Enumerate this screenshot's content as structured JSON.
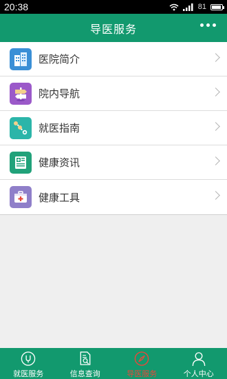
{
  "status_bar": {
    "time": "20:38",
    "battery_text": "81",
    "battery_level": 0.81
  },
  "header": {
    "title": "导医服务",
    "more_icon": "more-dots-icon"
  },
  "menu": {
    "items": [
      {
        "label": "医院简介",
        "icon": "hospital-building-icon",
        "color": "#3a8fd6"
      },
      {
        "label": "院内导航",
        "icon": "signpost-icon",
        "color": "#9b59c9"
      },
      {
        "label": "就医指南",
        "icon": "route-guide-icon",
        "color": "#2bb5a9"
      },
      {
        "label": "健康资讯",
        "icon": "health-news-icon",
        "color": "#21a27a"
      },
      {
        "label": "健康工具",
        "icon": "medical-kit-icon",
        "color": "#8f7fc9"
      }
    ]
  },
  "tabs": [
    {
      "label": "就医服务",
      "icon": "stethoscope-icon",
      "active": false
    },
    {
      "label": "信息查询",
      "icon": "document-search-icon",
      "active": false
    },
    {
      "label": "导医服务",
      "icon": "compass-icon",
      "active": true
    },
    {
      "label": "个人中心",
      "icon": "person-icon",
      "active": false
    }
  ],
  "colors": {
    "primary": "#12996e",
    "active_tab": "#e8483a"
  }
}
